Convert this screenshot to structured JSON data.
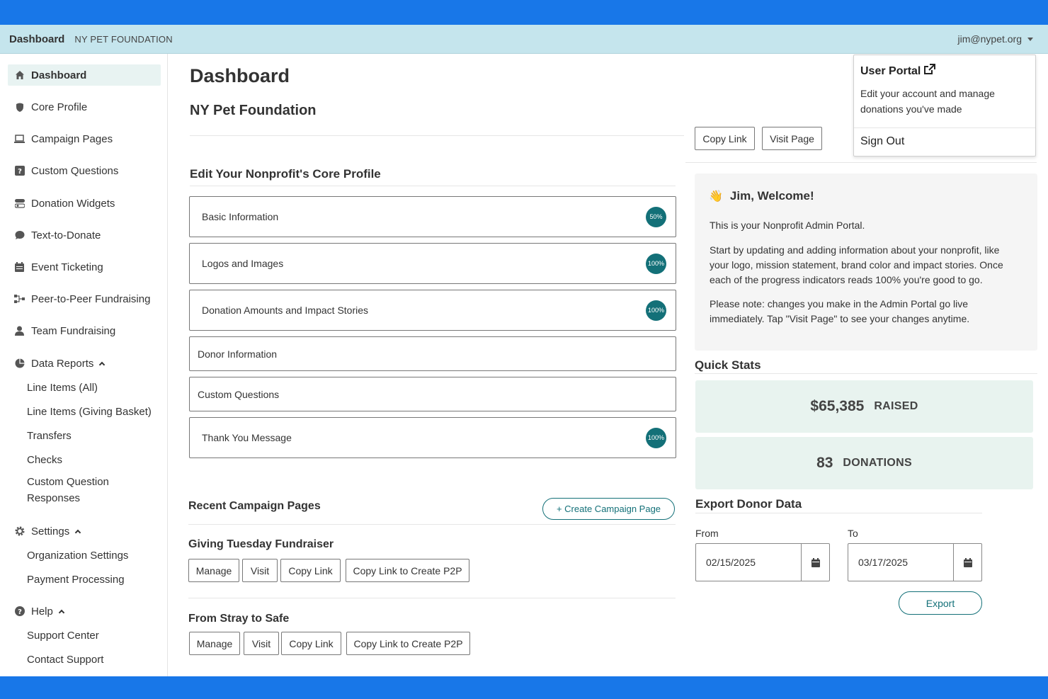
{
  "navbar": {
    "brand": "Dashboard",
    "org": "NY PET FOUNDATION",
    "user_email": "jim@nypet.org"
  },
  "sidebar": {
    "items": [
      {
        "label": "Dashboard",
        "icon": "home-icon"
      },
      {
        "label": "Core Profile",
        "icon": "shield-icon"
      },
      {
        "label": "Campaign Pages",
        "icon": "laptop-icon"
      },
      {
        "label": "Custom Questions",
        "icon": "question-square-icon"
      },
      {
        "label": "Donation Widgets",
        "icon": "toggle-icon"
      },
      {
        "label": "Text-to-Donate",
        "icon": "chat-bubble-icon"
      },
      {
        "label": "Event Ticketing",
        "icon": "calendar-icon"
      },
      {
        "label": "Peer-to-Peer Fundraising",
        "icon": "network-icon"
      },
      {
        "label": "Team Fundraising",
        "icon": "user-icon"
      }
    ],
    "data_reports": {
      "label": "Data Reports",
      "icon": "pie-chart-icon",
      "children": [
        "Line Items (All)",
        "Line Items (Giving Basket)",
        "Transfers",
        "Checks",
        "Custom Question Responses"
      ]
    },
    "settings": {
      "label": "Settings",
      "icon": "gear-icon",
      "children": [
        "Organization Settings",
        "Payment Processing"
      ]
    },
    "help": {
      "label": "Help",
      "icon": "help-circle-icon",
      "children": [
        "Support Center",
        "Contact Support"
      ]
    }
  },
  "main": {
    "title": "Dashboard",
    "org_name": "NY Pet Foundation",
    "copy_link": "Copy Link",
    "visit_page": "Visit Page",
    "core_profile": {
      "heading": "Edit Your Nonprofit's Core Profile",
      "sections": [
        {
          "label": "Basic Information",
          "progress": "50%"
        },
        {
          "label": "Logos and Images",
          "progress": "100%"
        },
        {
          "label": "Donation Amounts and Impact Stories",
          "progress": "100%"
        },
        {
          "label": "Donor Information",
          "progress": null
        },
        {
          "label": "Custom Questions",
          "progress": null
        },
        {
          "label": "Thank You Message",
          "progress": "100%"
        }
      ]
    },
    "recent_campaigns": {
      "heading": "Recent Campaign Pages",
      "create_button": "+ Create Campaign Page",
      "campaigns": [
        {
          "title": "Giving Tuesday Fundraiser",
          "actions": [
            "Manage",
            "Visit",
            "Copy Link",
            "Copy Link to Create P2P"
          ]
        },
        {
          "title": "From Stray to Safe",
          "actions": [
            "Manage",
            "Visit",
            "Copy Link",
            "Copy Link to Create P2P"
          ]
        }
      ]
    }
  },
  "user_menu": {
    "title": "User Portal",
    "description": "Edit your account and manage donations you've made",
    "sign_out": "Sign Out"
  },
  "welcome": {
    "emoji": "👋",
    "title": "Jim, Welcome!",
    "p1": "This is your Nonprofit Admin Portal.",
    "p2": "Start by updating and adding information about your nonprofit, like your logo, mission statement, brand color and impact stories. Once each of the progress indicators reads 100% you're good to go.",
    "p3": "Please note: changes you make in the Admin Portal go live immediately. Tap \"Visit Page\" to see your changes anytime."
  },
  "quick_stats": {
    "heading": "Quick Stats",
    "raised_value": "$65,385",
    "raised_label": "RAISED",
    "donations_value": "83",
    "donations_label": "DONATIONS"
  },
  "export": {
    "heading": "Export Donor Data",
    "from_label": "From",
    "from_value": "02/15/2025",
    "to_label": "To",
    "to_value": "03/17/2025",
    "button": "Export"
  },
  "colors": {
    "top_band": "#1877e8",
    "navbar_bg": "#c5e5ed",
    "accent_teal": "#137078",
    "stat_bg": "#e8f3ef"
  }
}
